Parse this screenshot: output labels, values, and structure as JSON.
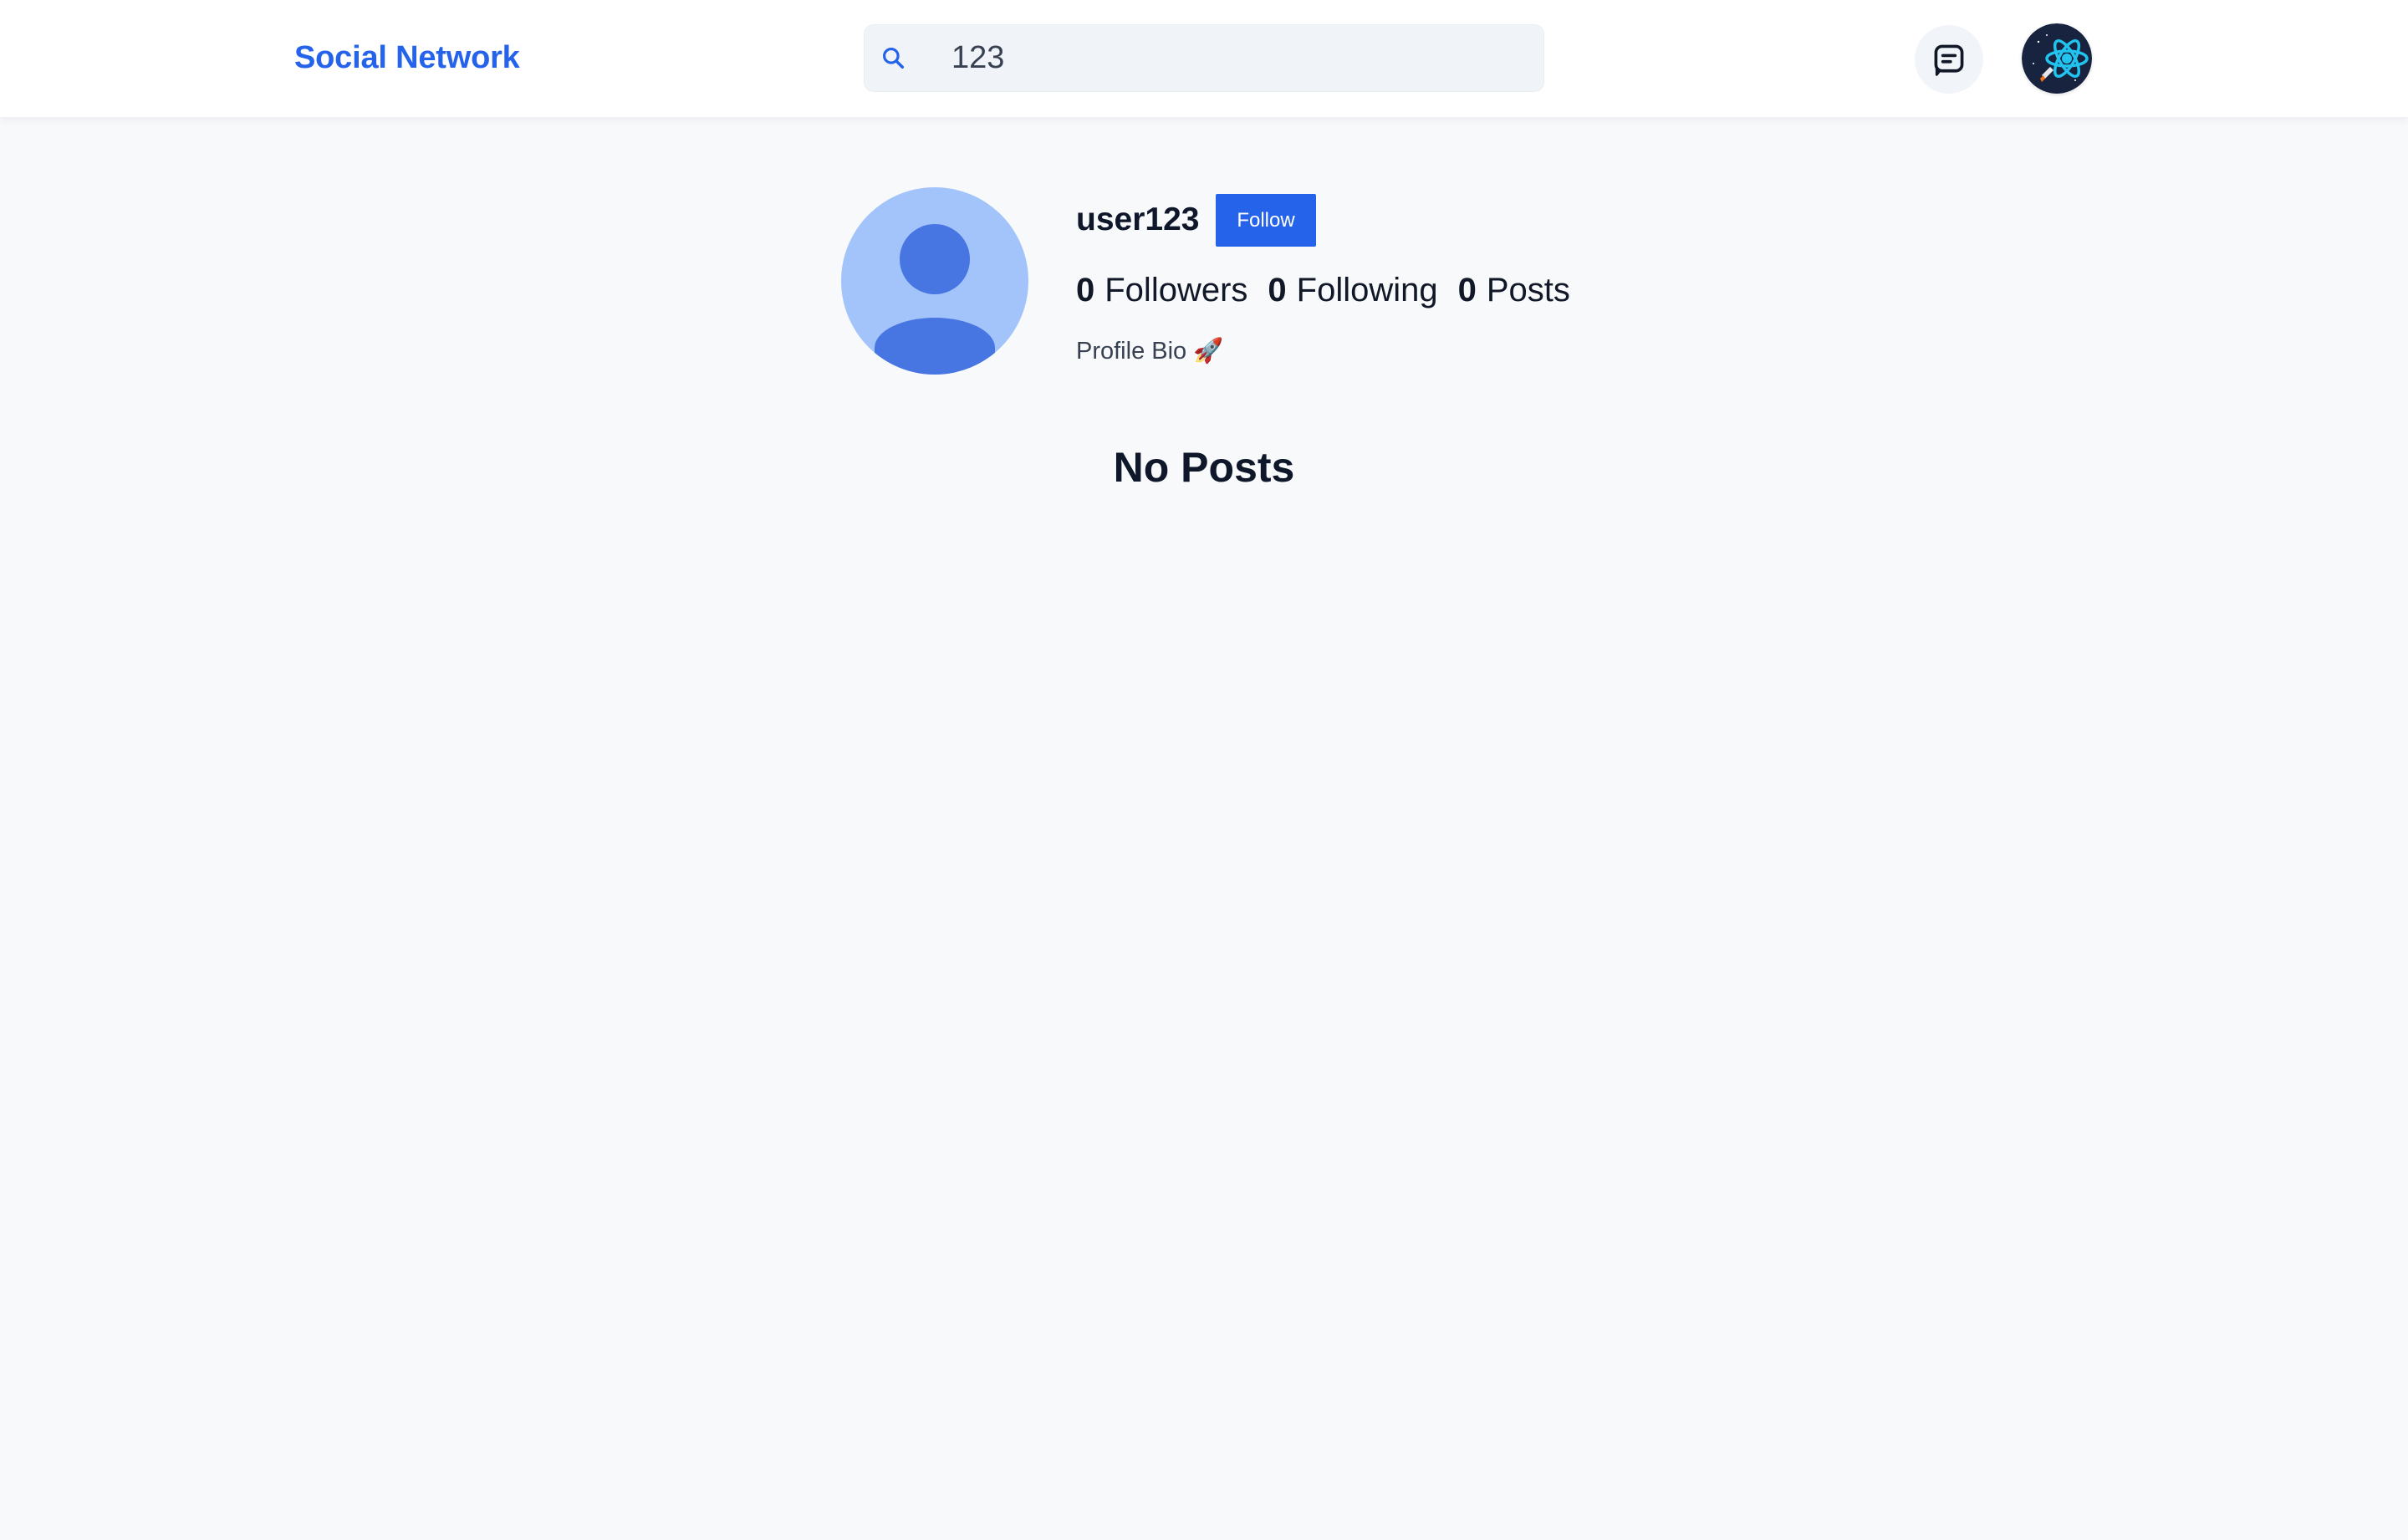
{
  "header": {
    "brand": "Social Network",
    "search": {
      "value": "123",
      "icon": "search-icon"
    },
    "messages_icon": "message-icon",
    "current_user_avatar": "user-avatar"
  },
  "profile": {
    "username": "user123",
    "follow_label": "Follow",
    "stats": [
      {
        "count": "0",
        "label": "Followers"
      },
      {
        "count": "0",
        "label": "Following"
      },
      {
        "count": "0",
        "label": "Posts"
      }
    ],
    "bio": "Profile Bio 🚀"
  },
  "posts": {
    "empty_message": "No Posts"
  },
  "colors": {
    "accent": "#2563eb",
    "page_background": "#f8f9fb",
    "avatar_light": "#a3c4fb",
    "avatar_dark": "#3f6fe0"
  }
}
